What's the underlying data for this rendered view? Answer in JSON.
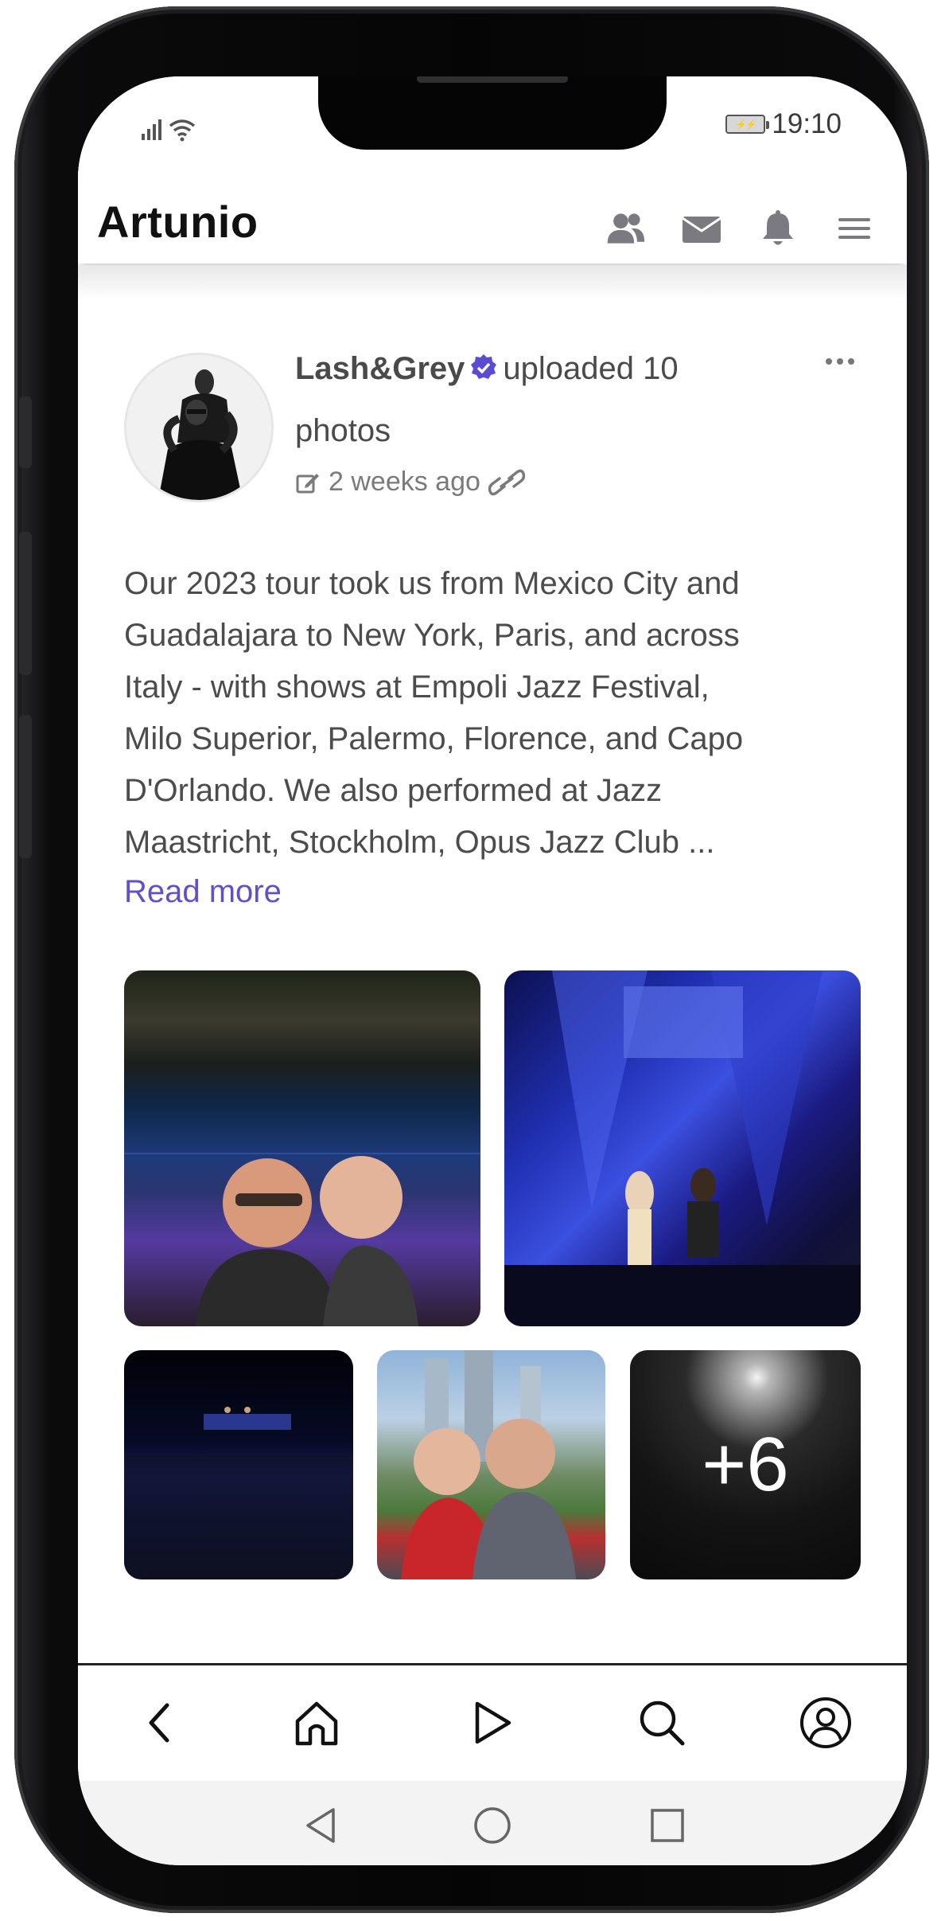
{
  "status_bar": {
    "time": "19:10"
  },
  "header": {
    "app_title": "Artunio",
    "icons": [
      "people-icon",
      "mail-icon",
      "bell-icon",
      "menu-icon"
    ]
  },
  "post": {
    "author": "Lash&Grey",
    "verified": true,
    "action": "uploaded 10 photos",
    "action_line1": "uploaded 10",
    "action_line2": "photos",
    "timestamp": "2 weeks ago",
    "body_lines": [
      "Our 2023 tour took us from Mexico City and",
      "Guadalajara to New York, Paris, and across",
      "Italy - with shows at Empoli Jazz Festival,",
      "Milo Superior, Palermo, Florence, and Capo",
      "D'Orlando. We also performed at Jazz",
      "Maastricht, Stockholm, Opus Jazz Club ..."
    ],
    "read_more": "Read more",
    "photos_shown": 5,
    "extra_photos_label": "+6"
  },
  "bottom_nav": {
    "items": [
      "back-icon",
      "home-icon",
      "play-icon",
      "search-icon",
      "profile-icon"
    ]
  },
  "system_nav": {
    "items": [
      "system-back-icon",
      "system-home-icon",
      "system-recents-icon"
    ]
  },
  "colors": {
    "accent": "#6051c8",
    "verified_badge": "#5b4bd0",
    "text": "#4a4a4a",
    "icon_gray": "#7a7a80"
  }
}
